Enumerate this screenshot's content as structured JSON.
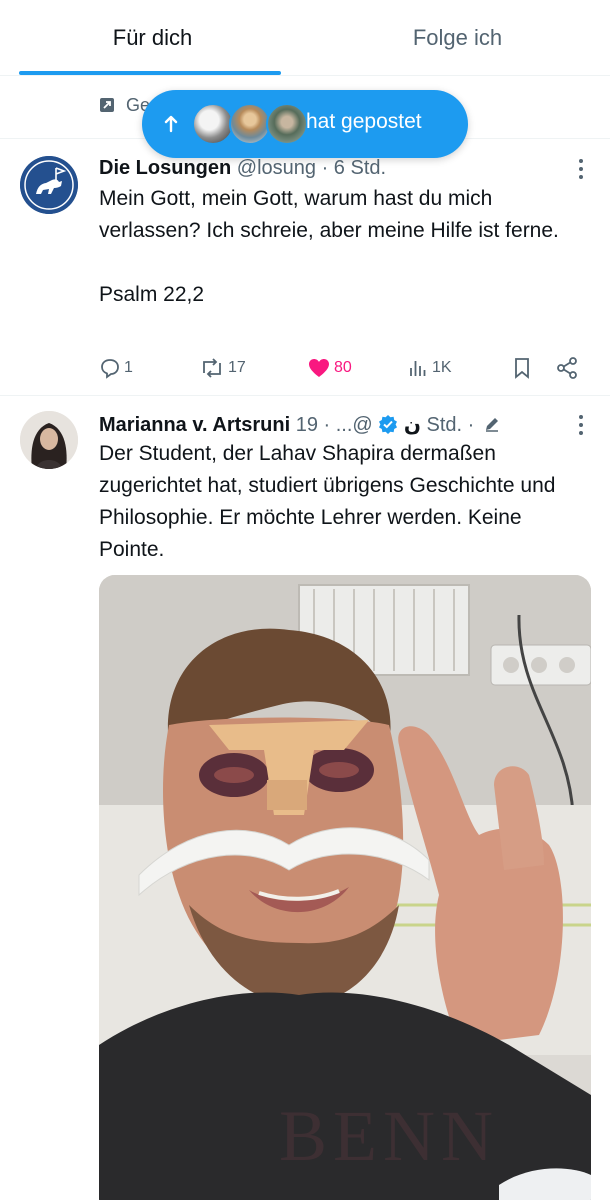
{
  "tabs": [
    {
      "label": "Für dich",
      "active": true
    },
    {
      "label": "Folge ich",
      "active": false
    }
  ],
  "trend_row": {
    "text": "Ge"
  },
  "new_posts_pill": {
    "label": "hat gepostet"
  },
  "posts": [
    {
      "author_name": "Die Losungen",
      "handle_time": " @losung · 6 Std.",
      "text": "Mein Gott, mein Gott, warum hast du mich verlassen? Ich schreie, aber meine Hilfe ist ferne.\n\nPsalm 22,2",
      "replies": "1",
      "reposts": "17",
      "likes": "80",
      "views": "1K"
    },
    {
      "author_name": "Marianna v. Artsruni",
      "name_suffix": " ن",
      "handle_time": " @... · 19 Std. ·",
      "text": "Der Student, der Lahav Shapira dermaßen zugerichtet hat, studiert übrigens Geschichte und Philosophie. Er möchte Lehrer werden. Keine Pointe."
    }
  ],
  "colors": {
    "accent": "#1d9bf0",
    "like": "#f91880",
    "muted": "#536471",
    "text": "#0f1419",
    "verified": "#1d9bf0"
  },
  "icons": [
    "external-link-icon",
    "arrow-up-icon",
    "more-icon",
    "reply-icon",
    "repost-icon",
    "like-icon",
    "views-icon",
    "bookmark-icon",
    "share-icon",
    "verified-badge-icon",
    "edited-pencil-icon"
  ]
}
